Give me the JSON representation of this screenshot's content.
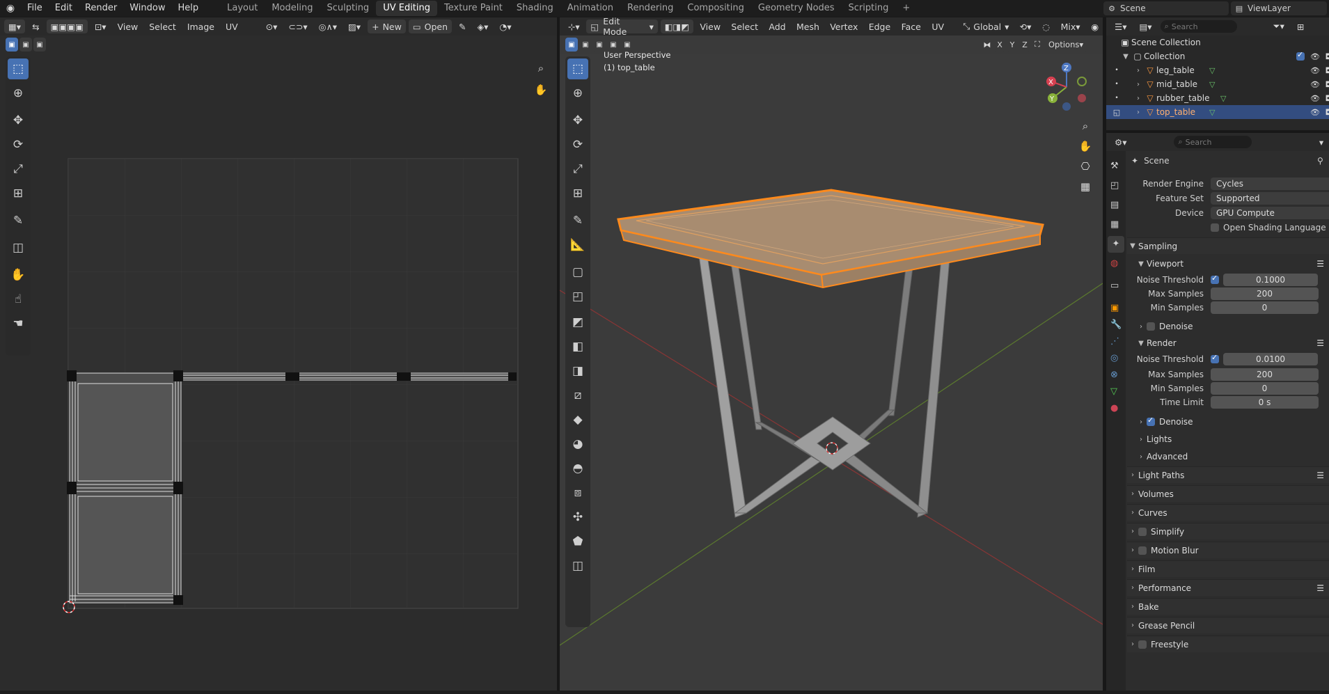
{
  "topbar": {
    "menus": [
      "File",
      "Edit",
      "Render",
      "Window",
      "Help"
    ],
    "workspaces": [
      "Layout",
      "Modeling",
      "Sculpting",
      "UV Editing",
      "Texture Paint",
      "Shading",
      "Animation",
      "Rendering",
      "Compositing",
      "Geometry Nodes",
      "Scripting"
    ],
    "active_workspace": "UV Editing",
    "add_workspace": "+",
    "scene_label": "Scene",
    "viewlayer_label": "ViewLayer"
  },
  "uv_editor": {
    "menus": [
      "View",
      "Select",
      "Image",
      "UV"
    ],
    "new_label": "New",
    "open_label": "Open",
    "tools": [
      "select-box",
      "cursor",
      "move",
      "rotate",
      "scale",
      "transform",
      "annotate",
      "rip-region",
      "grab",
      "relax",
      "pinch"
    ]
  },
  "viewport": {
    "mode": "Edit Mode",
    "menus": [
      "View",
      "Select",
      "Add",
      "Mesh",
      "Vertex",
      "Edge",
      "Face",
      "UV"
    ],
    "transform_orientation": "Global",
    "shading_mix": "Mix",
    "perspective_label": "User Perspective",
    "object_label": "(1) top_table",
    "options_label": "Options",
    "axis_x": "X",
    "axis_y": "Y",
    "axis_z": "Z"
  },
  "outliner": {
    "search_placeholder": "Search",
    "root": "Scene Collection",
    "collection": "Collection",
    "items": [
      {
        "name": "leg_table",
        "selected": false
      },
      {
        "name": "mid_table",
        "selected": false
      },
      {
        "name": "rubber_table",
        "selected": false
      },
      {
        "name": "top_table",
        "selected": true
      }
    ]
  },
  "properties": {
    "search_placeholder": "Search",
    "context": "Scene",
    "render_engine_label": "Render Engine",
    "render_engine": "Cycles",
    "feature_set_label": "Feature Set",
    "feature_set": "Supported",
    "device_label": "Device",
    "device": "GPU Compute",
    "osl_label": "Open Shading Language",
    "sampling": "Sampling",
    "viewport": "Viewport",
    "noise_threshold_label": "Noise Threshold",
    "vp_noise": "0.1000",
    "max_samples_label": "Max Samples",
    "vp_max": "200",
    "min_samples_label": "Min Samples",
    "vp_min": "0",
    "denoise_label": "Denoise",
    "render": "Render",
    "r_noise": "0.0100",
    "r_max": "200",
    "r_min": "0",
    "time_limit_label": "Time Limit",
    "r_time": "0 s",
    "lights": "Lights",
    "advanced": "Advanced",
    "panels": [
      "Light Paths",
      "Volumes",
      "Curves",
      "Simplify",
      "Motion Blur",
      "Film",
      "Performance",
      "Bake",
      "Grease Pencil",
      "Freestyle"
    ]
  },
  "colors": {
    "accent": "#4772b3",
    "selection": "#ff8a1c",
    "bg": "#2b2b2b"
  }
}
